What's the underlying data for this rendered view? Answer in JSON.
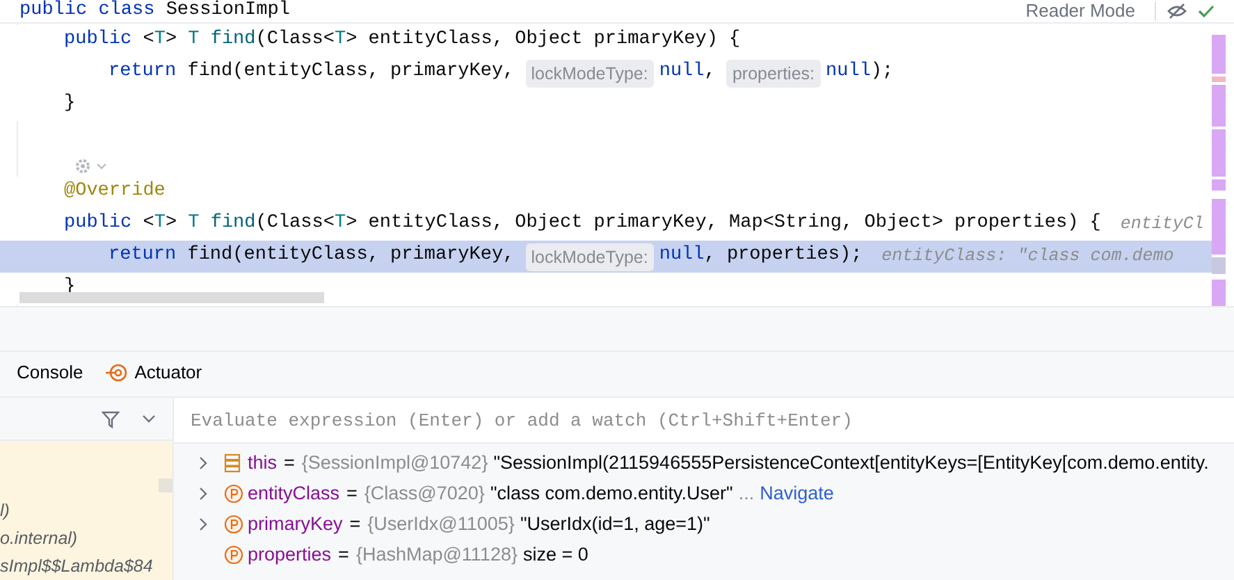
{
  "editor": {
    "sticky_line": [
      {
        "kind": "keyword",
        "text": "public class "
      },
      {
        "kind": "plain",
        "text": "SessionImpl"
      }
    ],
    "reader_mode": "Reader Mode",
    "lines": [
      {
        "kind": "member",
        "highlighted": false,
        "segments": [
          {
            "kind": "code",
            "tokens": [
              {
                "kind": "keyword",
                "text": "public "
              },
              {
                "kind": "plain",
                "text": "<"
              },
              {
                "kind": "type_param",
                "text": "T"
              },
              {
                "kind": "plain",
                "text": "> "
              },
              {
                "kind": "type_param",
                "text": "T "
              },
              {
                "kind": "method",
                "text": "find"
              },
              {
                "kind": "plain",
                "text": "(Class<"
              },
              {
                "kind": "type_param",
                "text": "T"
              },
              {
                "kind": "plain",
                "text": "> entityClass, Object primaryKey) {"
              }
            ]
          }
        ]
      },
      {
        "kind": "statement",
        "highlighted": false,
        "segments": [
          {
            "kind": "code",
            "tokens": [
              {
                "kind": "keyword",
                "text": "return "
              },
              {
                "kind": "plain",
                "text": "find(entityClass, primaryKey, "
              }
            ]
          },
          {
            "kind": "hint",
            "text": "lockModeType:"
          },
          {
            "kind": "code",
            "tokens": [
              {
                "kind": "keyword",
                "text": "null"
              },
              {
                "kind": "plain",
                "text": ", "
              }
            ]
          },
          {
            "kind": "hint",
            "text": "properties:"
          },
          {
            "kind": "code",
            "tokens": [
              {
                "kind": "keyword",
                "text": "null"
              },
              {
                "kind": "plain",
                "text": ");"
              }
            ]
          }
        ]
      },
      {
        "kind": "member",
        "highlighted": false,
        "segments": [
          {
            "kind": "code",
            "tokens": [
              {
                "kind": "plain",
                "text": "}"
              }
            ]
          }
        ]
      },
      {
        "kind": "blank"
      },
      {
        "kind": "inlay"
      },
      {
        "kind": "member",
        "highlighted": false,
        "segments": [
          {
            "kind": "code",
            "tokens": [
              {
                "kind": "annotation",
                "text": "@Override"
              }
            ]
          }
        ]
      },
      {
        "kind": "member",
        "highlighted": false,
        "segments": [
          {
            "kind": "code",
            "tokens": [
              {
                "kind": "keyword",
                "text": "public "
              },
              {
                "kind": "plain",
                "text": "<"
              },
              {
                "kind": "type_param",
                "text": "T"
              },
              {
                "kind": "plain",
                "text": "> "
              },
              {
                "kind": "type_param",
                "text": "T "
              },
              {
                "kind": "method",
                "text": "find"
              },
              {
                "kind": "plain",
                "text": "(Class<"
              },
              {
                "kind": "type_param",
                "text": "T"
              },
              {
                "kind": "plain",
                "text": "> entityClass, Object primaryKey, Map<String, Object> properties) {"
              }
            ]
          },
          {
            "kind": "value",
            "text": "entityCl"
          }
        ]
      },
      {
        "kind": "statement",
        "highlighted": true,
        "segments": [
          {
            "kind": "code",
            "tokens": [
              {
                "kind": "keyword",
                "text": "return "
              },
              {
                "kind": "plain",
                "text": "find(entityClass, primaryKey, "
              }
            ]
          },
          {
            "kind": "hint",
            "text": "lockModeType:"
          },
          {
            "kind": "code",
            "tokens": [
              {
                "kind": "keyword",
                "text": "null"
              },
              {
                "kind": "plain",
                "text": ", properties);"
              }
            ]
          },
          {
            "kind": "value",
            "text": "entityClass: \"class com.demo"
          }
        ]
      },
      {
        "kind": "member",
        "highlighted": false,
        "segments": [
          {
            "kind": "code",
            "tokens": [
              {
                "kind": "plain",
                "text": "}"
              }
            ]
          }
        ]
      }
    ]
  },
  "tabs": [
    {
      "label": "Console",
      "kind": "plain",
      "selected": false
    },
    {
      "label": "Actuator",
      "kind": "actuator",
      "selected": false
    }
  ],
  "frames": [
    {
      "text": "l)"
    },
    {
      "text": "o.internal)"
    },
    {
      "text": "sImpl$$Lambda$84"
    }
  ],
  "evaluate": {
    "placeholder": "Evaluate expression (Enter) or add a watch (Ctrl+Shift+Enter)"
  },
  "variables": [
    {
      "kind": "object",
      "expandable": true,
      "name": "this",
      "separator": "=",
      "type": "{SessionImpl@10742}",
      "value": "\"SessionImpl(2115946555PersistenceContext[entityKeys=[EntityKey[com.demo.entity."
    },
    {
      "kind": "param",
      "expandable": true,
      "name": "entityClass",
      "separator": "=",
      "type": "{Class@7020}",
      "value": "\"class com.demo.entity.User\"",
      "more": "...",
      "link": "Navigate"
    },
    {
      "kind": "param",
      "expandable": true,
      "name": "primaryKey",
      "separator": "=",
      "type": "{UserIdx@11005}",
      "value": "\"UserIdx(id=1, age=1)\""
    },
    {
      "kind": "param",
      "expandable": false,
      "name": "properties",
      "separator": "=",
      "type": "{HashMap@11128}",
      "value": "size = 0"
    }
  ]
}
